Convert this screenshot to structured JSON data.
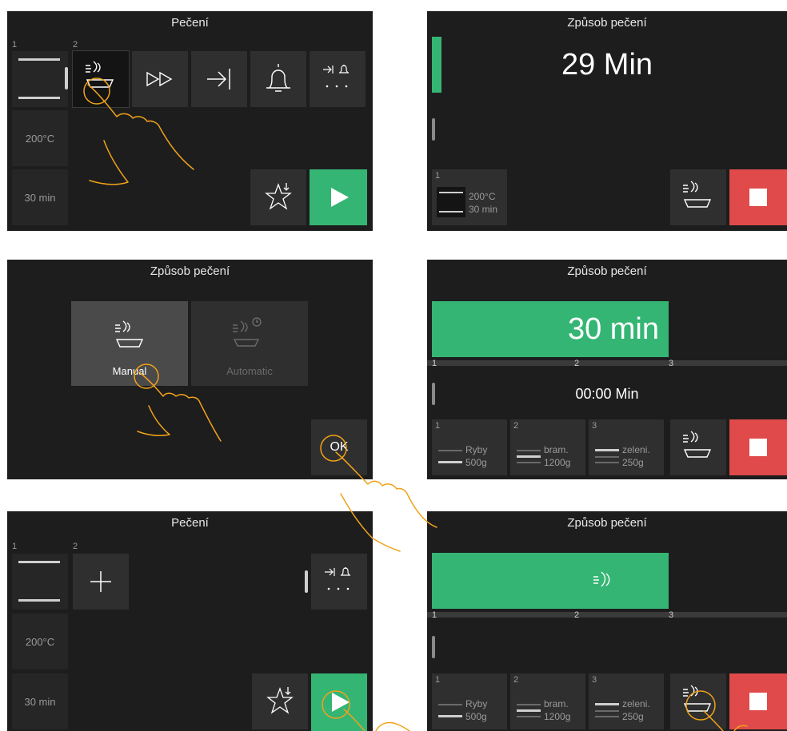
{
  "colors": {
    "accent_green": "#35b574",
    "stop_red": "#e04a4a",
    "panel_bg": "#1d1d1d",
    "tile_bg": "#2f2f2f",
    "hand_outline": "#f0a21a"
  },
  "panel1": {
    "title": "Pečení",
    "level_numbers": [
      "1",
      "2"
    ],
    "temperature": "200°C",
    "time": "30 min",
    "icons": [
      "steam-dish-icon",
      "fast-forward-icon",
      "arrow-to-line-icon",
      "bell-icon",
      "end-bell-more-icon",
      "favorite-star-icon",
      "play-icon"
    ]
  },
  "panel2": {
    "title": "Způsob pečení",
    "remaining": "29 Min",
    "level_number": "1",
    "temperature": "200°C",
    "time": "30 min",
    "icons": [
      "steam-dish-icon",
      "stop-icon"
    ]
  },
  "panel3": {
    "title": "Způsob pečení",
    "options": [
      {
        "label": "Manual",
        "icon": "steam-dish-icon"
      },
      {
        "label": "Automatic",
        "icon": "steam-dish-timer-icon"
      }
    ],
    "ok_label": "OK"
  },
  "panel4": {
    "title": "Způsob pečení",
    "duration": "30 min",
    "track_labels": [
      "1",
      "2",
      "3"
    ],
    "clock": "00:00 Min",
    "levels": [
      {
        "num": "1",
        "name": "Ryby",
        "weight": "500g"
      },
      {
        "num": "2",
        "name": "bram.",
        "weight": "1200g"
      },
      {
        "num": "3",
        "name": "zeleni.",
        "weight": "250g"
      }
    ]
  },
  "panel5": {
    "title": "Pečení",
    "level_numbers": [
      "1",
      "2"
    ],
    "temperature": "200°C",
    "time": "30 min",
    "icons": [
      "plus-icon",
      "end-bell-more-icon",
      "favorite-star-icon",
      "play-icon"
    ]
  },
  "panel6": {
    "title": "Způsob pečení",
    "track_labels": [
      "1",
      "2",
      "3"
    ],
    "levels": [
      {
        "num": "1",
        "name": "Ryby",
        "weight": "500g"
      },
      {
        "num": "2",
        "name": "bram.",
        "weight": "1200g"
      },
      {
        "num": "3",
        "name": "zeleni.",
        "weight": "250g"
      }
    ]
  }
}
